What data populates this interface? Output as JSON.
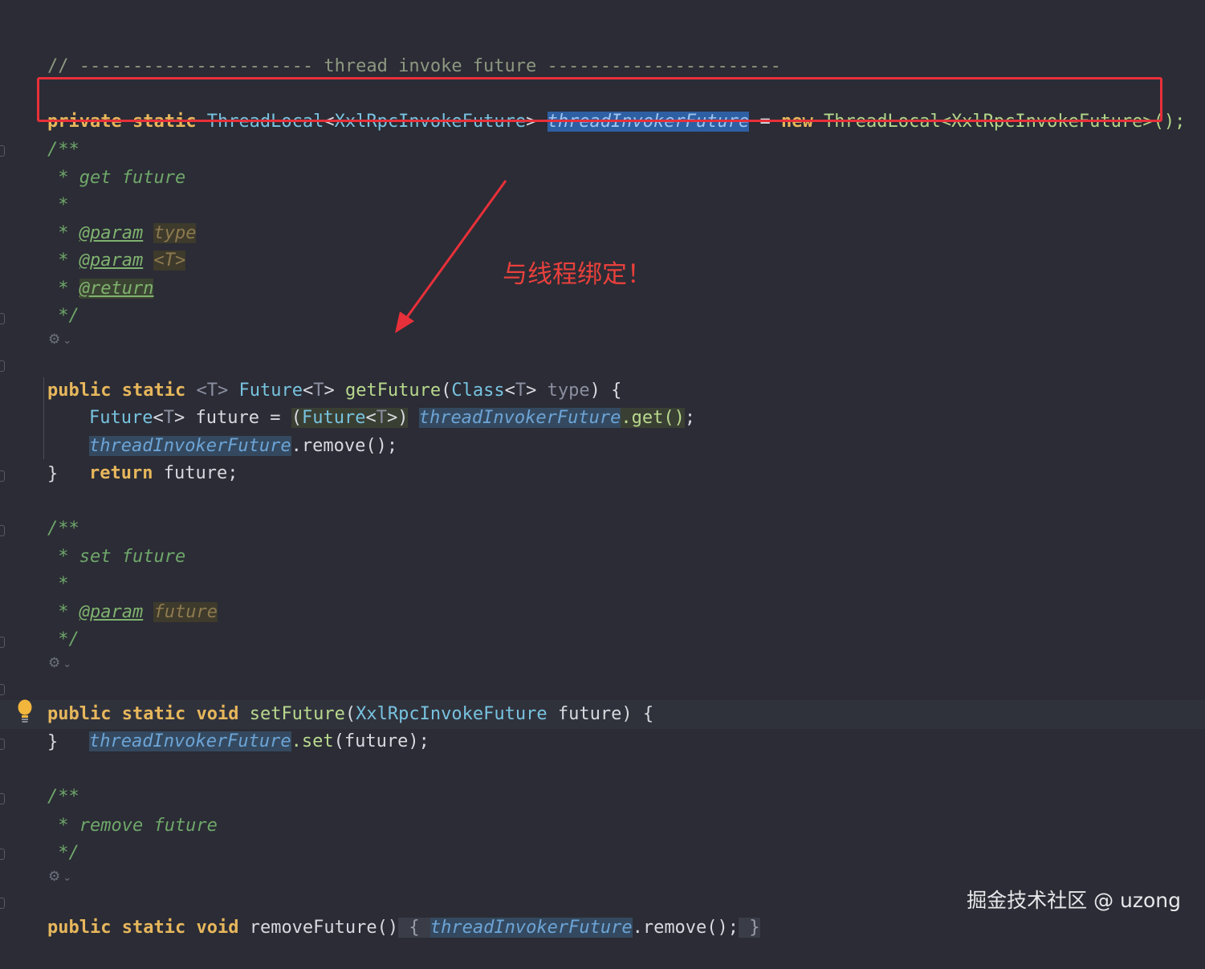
{
  "code": {
    "separator_comment": "// ---------------------- thread invoke future ----------------------",
    "field_decl": {
      "private": "private",
      "static": "static",
      "threadlocal_type": "ThreadLocal",
      "type_arg_open": "<",
      "type_arg": "XxlRpcInvokeFuture",
      "type_arg_close": ">",
      "field_name": "threadInvokerFuture",
      "assign": " = ",
      "new": "new",
      "ctor": "ThreadLocal<XxlRpcInvokeFuture>();"
    },
    "doc1": {
      "open": "/**",
      "line1": " * get future",
      "star": " *",
      "param_tag": "@param",
      "param1": "type",
      "param2": "<T>",
      "return_tag": "@return",
      "close": " */"
    },
    "getFuture": {
      "public": "public",
      "static": "static",
      "generic": "<T>",
      "return_type": "Future",
      "t": "T",
      "name": "getFuture",
      "param_type": "Class",
      "param_name": "type",
      "open_brace": "{",
      "local_type": "Future",
      "local_name": "future",
      "eq": "=",
      "cast": "(Future<T>)",
      "field": "threadInvokerFuture",
      "get_call": ".get()",
      "semi": ";",
      "remove_call": ".remove();",
      "return": "return",
      "return_val": "future;",
      "close_brace": "}"
    },
    "doc2": {
      "open": "/**",
      "line1": " * set future",
      "star": " *",
      "param_tag": "@param",
      "param1": "future",
      "close": " */"
    },
    "setFuture": {
      "public": "public",
      "static": "static",
      "void": "void",
      "name": "setFuture",
      "param_type": "XxlRpcInvokeFuture",
      "param_name": "future",
      "open_brace": "{",
      "field": "threadInvokerFuture",
      "set_call": ".set",
      "args": "(future);",
      "close_brace": "}"
    },
    "doc3": {
      "open": "/**",
      "line1": " * remove future",
      "close": " */"
    },
    "removeFuture": {
      "public": "public",
      "static": "static",
      "void": "void",
      "name": "removeFuture",
      "parens": "()",
      "open_brace": "{",
      "field": "threadInvokerFuture",
      "remove_call": ".remove();",
      "close_brace": "}"
    }
  },
  "annotation": "与线程绑定！",
  "watermark": "掘金技术社区 @ uzong",
  "colors": {
    "background": "#2b2c35",
    "annotation": "#e8403c",
    "highlight_box": "#e8303a",
    "keyword": "#e7b75c",
    "field": "#6da4d6"
  },
  "icons": [
    "gear-icon",
    "chevron-down-icon",
    "lightbulb-icon"
  ]
}
